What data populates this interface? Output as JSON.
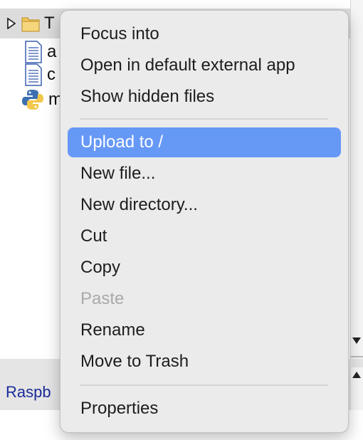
{
  "file_tree": {
    "root": {
      "label": "T",
      "icon": "folder-icon",
      "expanded": false
    },
    "children": [
      {
        "label": "a",
        "icon": "text-file-icon"
      },
      {
        "label": "c",
        "icon": "text-file-icon"
      },
      {
        "label": "m",
        "icon": "python-file-icon"
      }
    ]
  },
  "status_bar": {
    "text": "Raspb"
  },
  "context_menu": {
    "items": [
      {
        "label": "Focus into",
        "state": "normal"
      },
      {
        "label": "Open in default external app",
        "state": "normal"
      },
      {
        "label": "Show hidden files",
        "state": "normal"
      },
      {
        "separator": true
      },
      {
        "label": "Upload to /",
        "state": "highlighted"
      },
      {
        "label": "New file...",
        "state": "normal"
      },
      {
        "label": "New directory...",
        "state": "normal"
      },
      {
        "label": "Cut",
        "state": "normal"
      },
      {
        "label": "Copy",
        "state": "normal"
      },
      {
        "label": "Paste",
        "state": "disabled"
      },
      {
        "label": "Rename",
        "state": "normal"
      },
      {
        "label": "Move to Trash",
        "state": "normal"
      },
      {
        "separator": true
      },
      {
        "label": "Properties",
        "state": "normal"
      }
    ]
  },
  "colors": {
    "highlight": "#6698f6",
    "menu_background": "#ebebeb",
    "disabled_text": "#aaaaaa",
    "status_text": "#1a2b9a"
  }
}
